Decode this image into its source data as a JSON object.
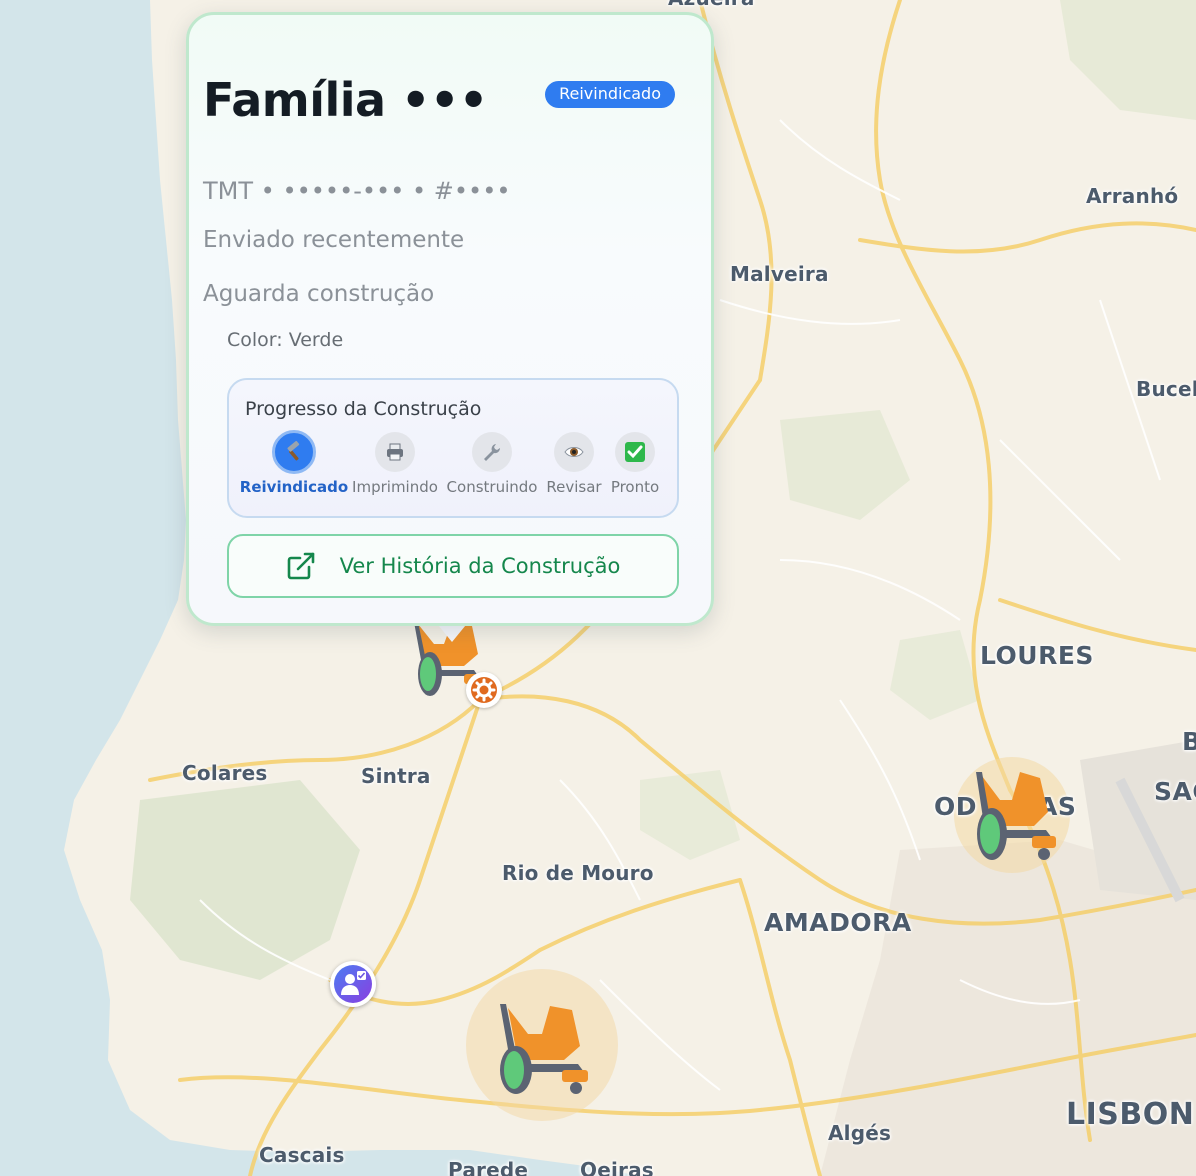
{
  "map": {
    "places": [
      {
        "name": "Azueira"
      },
      {
        "name": "Arranhó"
      },
      {
        "name": "Malveira"
      },
      {
        "name": "Bucel"
      },
      {
        "name": "LOURES"
      },
      {
        "name": "B"
      },
      {
        "name": "SAC"
      },
      {
        "name": "OD"
      },
      {
        "name": "AS"
      },
      {
        "name": "Colares"
      },
      {
        "name": "Sintra"
      },
      {
        "name": "Rio de Mouro"
      },
      {
        "name": "AMADORA"
      },
      {
        "name": "Algés"
      },
      {
        "name": "LISBON"
      },
      {
        "name": "Cascais"
      },
      {
        "name": "Parede"
      },
      {
        "name": "Oeiras"
      }
    ],
    "markers": [
      {
        "type": "wheelchair",
        "badge": "gear-icon",
        "badge_color": "#e06a1f"
      },
      {
        "type": "wheelchair",
        "highlighted": true
      },
      {
        "type": "wheelchair",
        "highlighted": true
      },
      {
        "type": "clinician",
        "badge_color": "#6b56e0"
      }
    ]
  },
  "popup": {
    "title": "Família •••",
    "badge": "Reivindicado",
    "badge_color": "#2f7cf0",
    "id_line": "TMT • •••••-••• • #••••",
    "sent": "Enviado recentemente",
    "status": "Aguarda construção",
    "color_line": "Color: Verde",
    "progress": {
      "title": "Progresso da Construção",
      "current_step": 0,
      "steps": [
        {
          "label": "Reivindicado",
          "icon": "hammer-icon"
        },
        {
          "label": "Imprimindo",
          "icon": "printer-icon"
        },
        {
          "label": "Construindo",
          "icon": "wrench-icon"
        },
        {
          "label": "Revisar",
          "icon": "eye-icon"
        },
        {
          "label": "Pronto",
          "icon": "check-box-icon"
        }
      ]
    },
    "history_button": {
      "label": "Ver História da Construção",
      "icon": "external-link-icon"
    },
    "accent": "#15874c"
  }
}
